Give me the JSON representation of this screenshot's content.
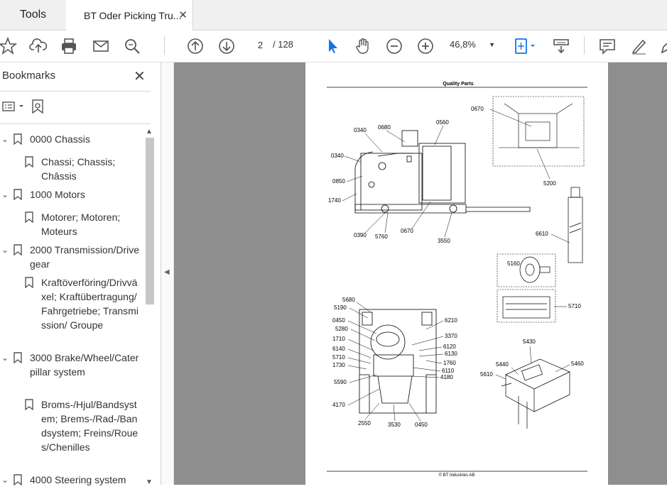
{
  "tabs": {
    "tools": "Tools",
    "document": "BT Oder Picking Tru...",
    "close": "✕"
  },
  "toolbar": {
    "page_current": "2",
    "page_total": "/ 128",
    "zoom": "46,8%"
  },
  "sidebar": {
    "title": "Bookmarks",
    "items": [
      {
        "label": "0000 Chassis",
        "level": 0
      },
      {
        "label": "Chassi; Chassis; Châssis",
        "level": 1
      },
      {
        "label": "1000 Motors",
        "level": 0
      },
      {
        "label": "Motorer; Motoren; Moteurs",
        "level": 1
      },
      {
        "label": "2000 Transmission/Drive gear",
        "level": 0
      },
      {
        "label": "Kraftöverföring/Drivväxel; Kraftübertragung/Fahrgetriebe; Transmission/ Groupe",
        "level": 1
      },
      {
        "label": "3000 Brake/Wheel/Caterpillar system",
        "level": 0
      },
      {
        "label": "Broms-/Hjul/Bandsystem; Brems-/Rad-/Bandsystem; Freins/Roues/Chenilles",
        "level": 1
      },
      {
        "label": "4000 Steering system",
        "level": 0
      }
    ]
  },
  "document": {
    "header": "Quality Parts",
    "footer": "© BT Industries AB",
    "labels": {
      "a0340": "0340",
      "a0680": "0680",
      "a0560": "0560",
      "a0340b": "0340",
      "a0850": "0850",
      "a1740": "1740",
      "a0390": "0390",
      "a5760": "5760",
      "a0670": "0670",
      "a3550": "3550",
      "b0670": "0670",
      "b5200": "5200",
      "b6610": "6610",
      "b5160": "5160",
      "b5710": "5710",
      "c5680": "5680",
      "c5190": "5190",
      "c0450": "0450",
      "c5280": "5280",
      "c1710": "1710",
      "c6140": "6140",
      "c5710": "5710",
      "c1730": "1730",
      "c5590": "5590",
      "c4170": "4170",
      "c2550": "2550",
      "c3530": "3530",
      "c0450b": "0450",
      "c6210": "6210",
      "c3370": "3370",
      "c6120": "6120",
      "c6130": "6130",
      "c1760": "1760",
      "c6110": "6110",
      "c4180": "4180",
      "d5430": "5430",
      "d5440": "5440",
      "d5610": "5610",
      "d5460": "5460"
    }
  }
}
